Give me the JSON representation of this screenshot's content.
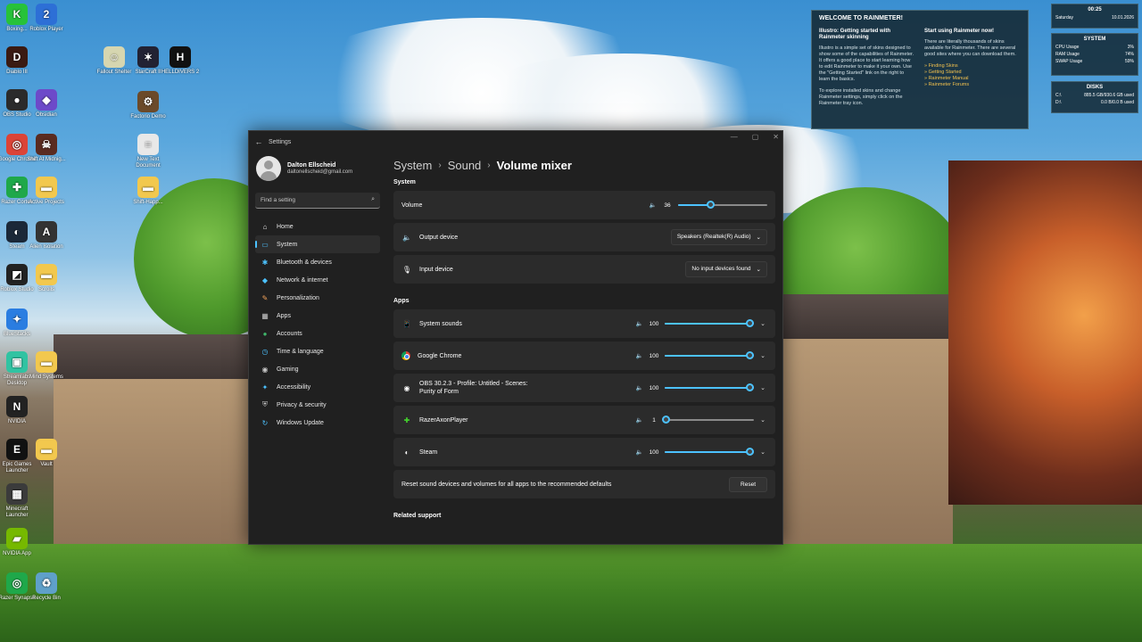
{
  "desktop": {
    "icons": [
      {
        "label": "Boxing...",
        "color": "#27c23a",
        "glyph": "K"
      },
      {
        "label": "Roblox Player",
        "color": "#2d6fd6",
        "glyph": "2"
      },
      {
        "label": "Diablo III",
        "color": "#3a1a12",
        "glyph": "D"
      },
      {
        "label": "OBS Studio",
        "color": "#2b2b2b",
        "glyph": "●"
      },
      {
        "label": "Obsidian",
        "color": "#6d4ac9",
        "glyph": "◆"
      },
      {
        "label": "Google Chrome",
        "color": "#db4437",
        "glyph": "◎"
      },
      {
        "label": "Shift At Midnig...",
        "color": "#5a2b20",
        "glyph": "☠"
      },
      {
        "label": "Razer Cortex",
        "color": "#1fa84a",
        "glyph": "✚"
      },
      {
        "label": "Active Projects",
        "color": "#f2c84e",
        "glyph": "▬"
      },
      {
        "label": "Steam",
        "color": "#1b2838",
        "glyph": "◐"
      },
      {
        "label": "Alien Isolation",
        "color": "#333",
        "glyph": "A"
      },
      {
        "label": "Roblox Studio",
        "color": "#222",
        "glyph": "◩"
      },
      {
        "label": "Scrolls",
        "color": "#f2c84e",
        "glyph": "▬"
      },
      {
        "label": "BlueStacks",
        "color": "#2a7de1",
        "glyph": "✦"
      },
      {
        "label": "Streamlabs Desktop",
        "color": "#31c3a2",
        "glyph": "▣"
      },
      {
        "label": "Mind Systems",
        "color": "#f2c84e",
        "glyph": "▬"
      },
      {
        "label": "NVIDIA",
        "color": "#222",
        "glyph": "N"
      },
      {
        "label": "Epic Games Launcher",
        "color": "#111",
        "glyph": "E"
      },
      {
        "label": "Vault",
        "color": "#f2c84e",
        "glyph": "▬"
      },
      {
        "label": "Minecraft Launcher",
        "color": "#3b3b3b",
        "glyph": "▦"
      },
      {
        "label": "NVIDIA App",
        "color": "#76b900",
        "glyph": "▰"
      },
      {
        "label": "Razer Synapse",
        "color": "#1fa84a",
        "glyph": "◎"
      },
      {
        "label": "Recycle Bin",
        "color": "#5fa0c9",
        "glyph": "♻"
      },
      {
        "label": "Fallout Shelter",
        "color": "#d6d6b0",
        "glyph": "☺"
      },
      {
        "label": "StarCraft II",
        "color": "#223",
        "glyph": "✶"
      },
      {
        "label": "HELLDIVERS 2",
        "color": "#111",
        "glyph": "H"
      },
      {
        "label": "Factorio Demo",
        "color": "#6b4a2a",
        "glyph": "⚙"
      },
      {
        "label": "New Text Document",
        "color": "#e8e8e8",
        "glyph": "≡"
      },
      {
        "label": "Shift-Happ...",
        "color": "#f2c84e",
        "glyph": "▬"
      }
    ]
  },
  "rainmeter": {
    "welcome_title": "WELCOME TO RAINMETER!",
    "col1_title": "Illustro: Getting started with Rainmeter skinning",
    "col1_p1": "Illustro is a simple set of skins designed to show some of the capabilities of Rainmeter. It offers a good place to start learning how to edit Rainmeter to make it your own. Use the \"Getting Started\" link on the right to learn the basics.",
    "col1_p2": "To explore installed skins and change Rainmeter settings, simply click on the Rainmeter tray icon.",
    "col2_title": "Start using Rainmeter now!",
    "col2_p1": "There are literally thousands of skins available for Rainmeter. There are several good sites where you can download them.",
    "links": [
      "» Finding Skins",
      "» Getting Started",
      "» Rainmeter Manual",
      "» Rainmeter Forums"
    ],
    "clock_time": "00:25",
    "clock_day": "Saturday",
    "clock_date": "10.01.2026",
    "system_title": "SYSTEM",
    "cpu_label": "CPU Usage",
    "cpu_value": "3%",
    "ram_label": "RAM Usage",
    "ram_value": "74%",
    "swap_label": "SWAP Usage",
    "swap_value": "59%",
    "disks_title": "DISKS",
    "disk_c_label": "C:\\",
    "disk_c_value": "885.5 GB/930.6 GB used",
    "disk_d_label": "D:\\",
    "disk_d_value": "0.0 B/0.0 B used"
  },
  "window": {
    "title": "Settings",
    "back": "←",
    "minimize": "—",
    "maximize": "▢",
    "close": "✕",
    "profile": {
      "name": "Dalton Ellscheid",
      "email": "daltonellscheid@gmail.com"
    },
    "search_placeholder": "Find a setting",
    "nav": [
      {
        "label": "Home",
        "icon": "⌂",
        "color": "#e8e8e8"
      },
      {
        "label": "System",
        "icon": "▭",
        "color": "#4cc2ff"
      },
      {
        "label": "Bluetooth & devices",
        "icon": "✱",
        "color": "#4cc2ff"
      },
      {
        "label": "Network & internet",
        "icon": "◆",
        "color": "#4cc2ff"
      },
      {
        "label": "Personalization",
        "icon": "✎",
        "color": "#f0a25a"
      },
      {
        "label": "Apps",
        "icon": "▦",
        "color": "#c8c8c8"
      },
      {
        "label": "Accounts",
        "icon": "●",
        "color": "#3fb56a"
      },
      {
        "label": "Time & language",
        "icon": "◷",
        "color": "#4cc2ff"
      },
      {
        "label": "Gaming",
        "icon": "◉",
        "color": "#c8c8c8"
      },
      {
        "label": "Accessibility",
        "icon": "✦",
        "color": "#4cc2ff"
      },
      {
        "label": "Privacy & security",
        "icon": "⛨",
        "color": "#c8c8c8"
      },
      {
        "label": "Windows Update",
        "icon": "↻",
        "color": "#4cc2ff"
      }
    ],
    "breadcrumb": {
      "l1": "System",
      "l2": "Sound",
      "l3": "Volume mixer",
      "sep": "›"
    },
    "system_section": "System",
    "volume_label": "Volume",
    "volume_value": "36",
    "volume_level": 36,
    "output_label": "Output device",
    "output_value": "Speakers (Realtek(R) Audio)",
    "input_label": "Input device",
    "input_value": "No input devices found",
    "apps_section": "Apps",
    "apps": [
      {
        "name": "System sounds",
        "value": "100",
        "level": 100
      },
      {
        "name": "Google Chrome",
        "value": "100",
        "level": 100
      },
      {
        "name": "OBS 30.2.3 - Profile: Untitled - Scenes: Purity of Form",
        "value": "100",
        "level": 100
      },
      {
        "name": "RazerAxonPlayer",
        "value": "1",
        "level": 1
      },
      {
        "name": "Steam",
        "value": "100",
        "level": 100
      }
    ],
    "reset_text": "Reset sound devices and volumes for all apps to the recommended defaults",
    "reset_button": "Reset",
    "related_support": "Related support"
  }
}
